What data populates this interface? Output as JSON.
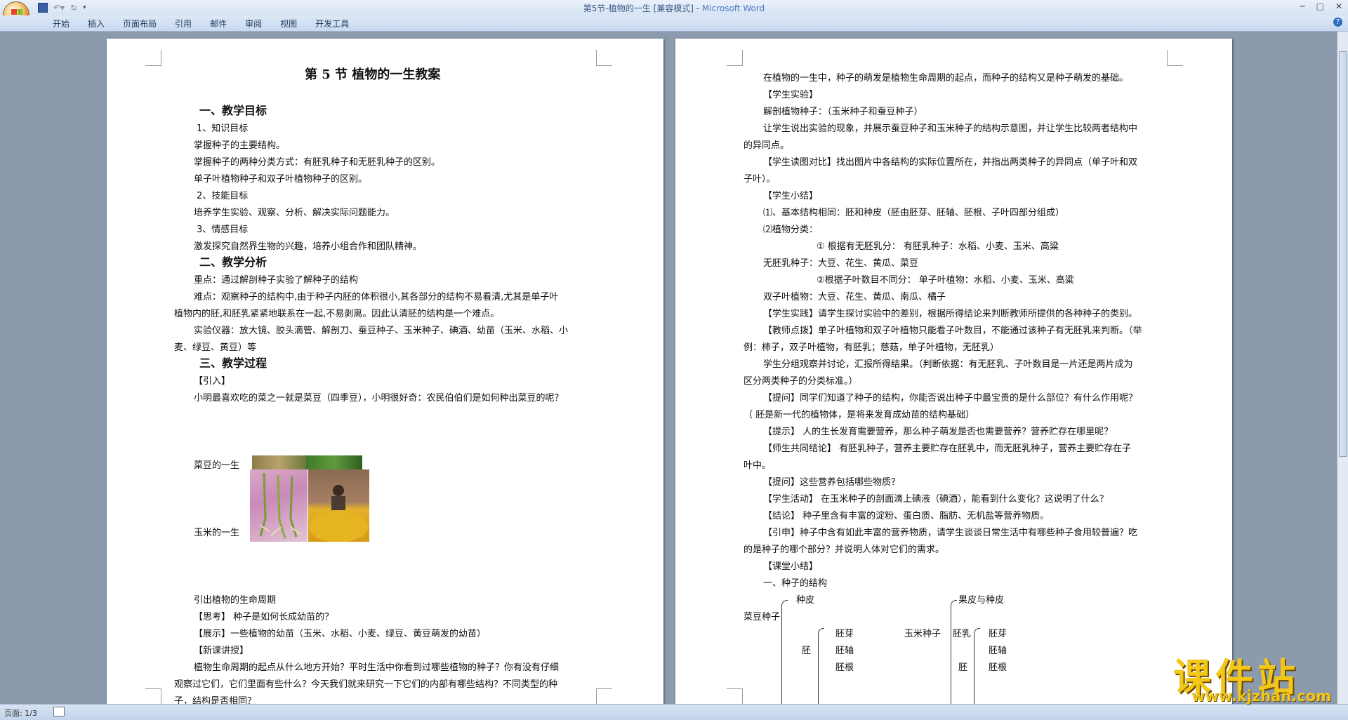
{
  "window": {
    "title": "第5节-植物的一生 [兼容模式] - ",
    "app_name": "Microsoft Word"
  },
  "ribbon": {
    "tabs": [
      "开始",
      "插入",
      "页面布局",
      "引用",
      "邮件",
      "审阅",
      "视图",
      "开发工具"
    ]
  },
  "status": {
    "page": "页面: 1/3"
  },
  "watermark": {
    "site_name": "课件站",
    "url": "www.kjzhan.com"
  },
  "page1": {
    "title": "第 5 节  植物的一生教案",
    "sec1": "一、教学目标",
    "sub1": "1、知识目标",
    "k1": "掌握种子的主要结构。",
    "k2": "掌握种子的两种分类方式：有胚乳种子和无胚乳种子的区别。",
    "k3": "单子叶植物种子和双子叶植物种子的区别。",
    "sub2": "2、技能目标",
    "s1": "培养学生实验、观察、分析、解决实际问题能力。",
    "sub3": "3、情感目标",
    "e1": "激发探究自然界生物的兴趣，培养小组合作和团队精神。",
    "sec2": "二、教学分析",
    "a1": "重点：通过解剖种子实验了解种子的结构",
    "a2a": "难点：观察种子的结构中,由于种子内胚的体积很小,其各部分的结构不易看清,尤其是单子叶",
    "a2b": "植物内的胚,和胚乳紧紧地联系在一起,不易剥离。因此认清胚的结构是一个难点。",
    "a3a": "实验仪器：放大镜、胶头滴管、解剖刀、蚕豆种子、玉米种子、碘酒、幼苗（玉米、水稻、小",
    "a3b": "麦、绿豆、黄豆）等",
    "sec3": "三、教学过程",
    "intro": "【引入】",
    "q1": "小明最喜欢吃的菜之一就是菜豆（四季豆），小明很好奇：农民伯伯们是如何种出菜豆的呢？",
    "bean_life": "菜豆的一生",
    "corn_life": "玉米的一生",
    "cycle": "引出植物的生命周期",
    "think": "【思考】   种子是如何长成幼苗的？",
    "show": "【展示】一些植物的幼苗（玉米、水稻、小麦、绿豆、黄豆萌发的幼苗）",
    "newlesson": "【新课讲授】",
    "p_a": "植物生命周期的起点从什么地方开始？平时生活中你看到过哪些植物的种子？你有没有仔细",
    "p_b": "观察过它们，它们里面有些什么？今天我们就来研究一下它们的内部有哪些结构？不同类型的种",
    "p_c": "子，结构是否相同？"
  },
  "page2": {
    "l1": "在植物的一生中，种子的萌发是植物生命周期的起点，而种子的结构又是种子萌发的基础。",
    "l2": "【学生实验】",
    "l3": "解剖植物种子：（玉米种子和蚕豆种子）",
    "l4a": "让学生说出实验的现象，并展示蚕豆种子和玉米种子的结构示意图，并让学生比较两者结构中",
    "l4b": "的异同点。",
    "l5a": "【学生读图对比】找出图片中各结构的实际位置所在，并指出两类种子的异同点（单子叶和双",
    "l5b": "子叶）。",
    "l6": "【学生小结】",
    "l7": "⑴、基本结构相同：胚和种皮（胚由胚芽、胚轴、胚根、子叶四部分组成）",
    "l8": "⑵植物分类：",
    "l9": "①  根据有无胚乳分：  有胚乳种子：水稻、小麦、玉米、高粱",
    "l10": "无胚乳种子：大豆、花生、黄瓜、菜豆",
    "l11": "②根据子叶数目不同分：  单子叶植物：水稻、小麦、玉米、高粱",
    "l12": "双子叶植物：大豆、花生、黄瓜、南瓜、橘子",
    "l13": "【学生实践】请学生探讨实验中的差别，根据所得结论来判断教师所提供的各种种子的类别。",
    "l14a": "【教师点拨】单子叶植物和双子叶植物只能看子叶数目，不能通过该种子有无胚乳来判断。（举",
    "l14b": "例：柿子，双子叶植物，有胚乳；慈菇，单子叶植物，无胚乳）",
    "l15a": "学生分组观察并讨论，汇报所得结果。（判断依据：有无胚乳、子叶数目是一片还是两片成为",
    "l15b": "区分两类种子的分类标准。）",
    "l16a": "【提问】同学们知道了种子的结构，你能否说出种子中最宝贵的是什么部位？有什么作用呢？",
    "l16b": "（  胚是新一代的植物体，是将来发育成幼苗的结构基础）",
    "l17": "【提示】 人的生长发育需要营养，那么种子萌发是否也需要营养？营养贮存在哪里呢？",
    "l18a": "【师生共同结论】  有胚乳种子，营养主要贮存在胚乳中，而无胚乳种子，营养主要贮存在子",
    "l18b": "叶中。",
    "l19": "【提问】这些营养包括哪些物质？",
    "l20": "【学生活动】 在玉米种子的剖面滴上碘液（碘酒），能看到什么变化？这说明了什么？",
    "l21": "【结论】 种子里含有丰富的淀粉、蛋白质、脂肪、无机盐等营养物质。",
    "l22a": "【引申】种子中含有如此丰富的营养物质，请学生谈谈日常生活中有哪些种子食用较普遍？吃",
    "l22b": "的是种子的哪个部分？并说明人体对它们的需求。",
    "l23": "【课堂小结】",
    "l24": "一、种子的结构",
    "d_bean": "菜豆种子",
    "d_coat": "种皮",
    "d_embryo": "胚",
    "d_plumule": "胚芽",
    "d_axis": "胚轴",
    "d_radicle": "胚根",
    "d_corn": "玉米种子",
    "d_fruitcoat": "果皮与种皮",
    "d_endosperm": "胚乳",
    "d_embryo2": "胚",
    "d_plumule2": "胚芽",
    "d_axis2": "胚轴",
    "d_radicle2": "胚根"
  }
}
